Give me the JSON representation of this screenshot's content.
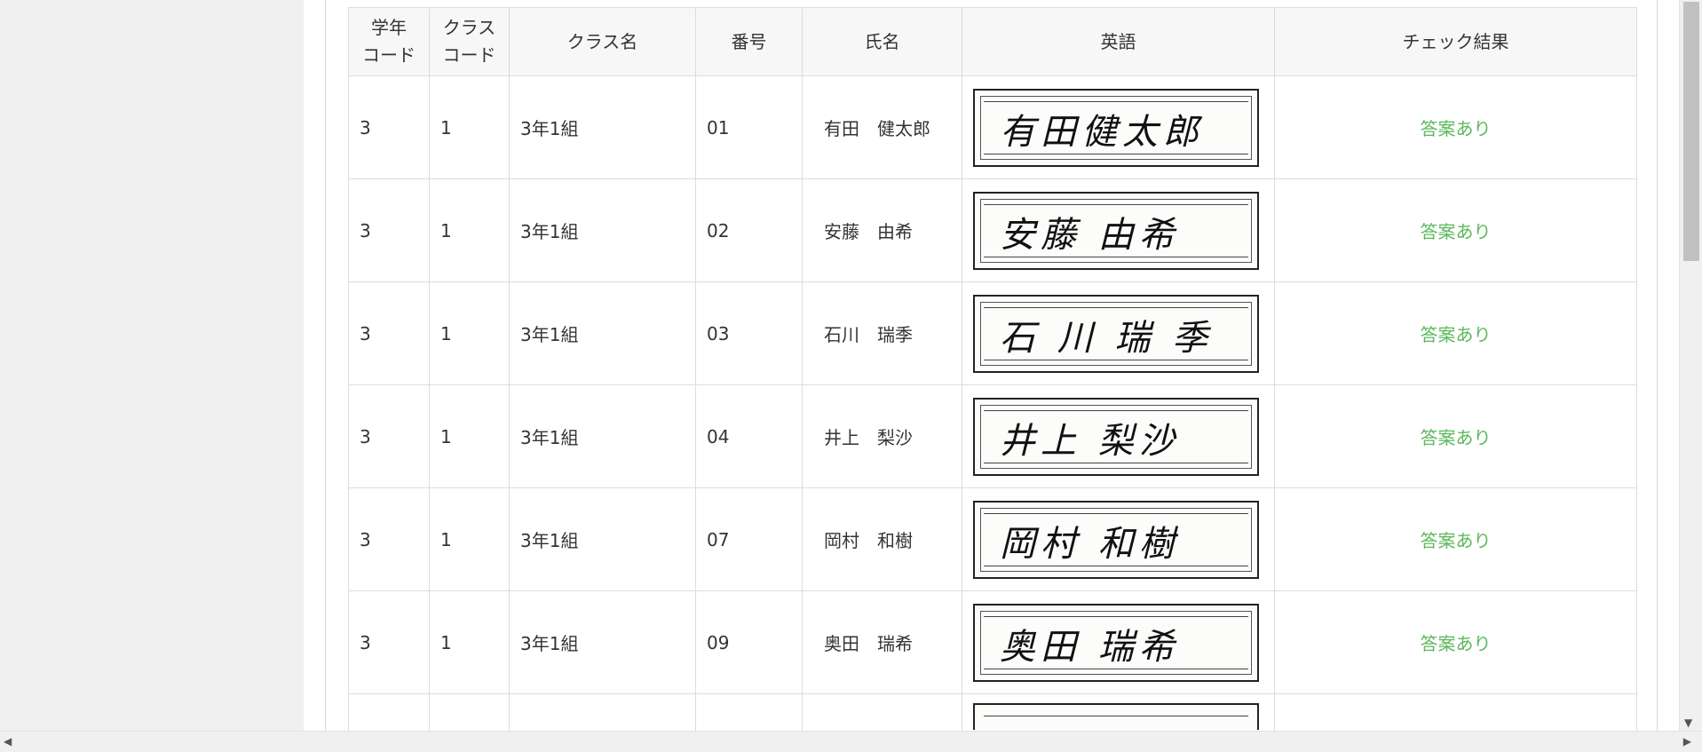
{
  "table": {
    "headers": [
      "学年\nコード",
      "クラス\nコード",
      "クラス名",
      "番号",
      "氏名",
      "英語",
      "チェック結果"
    ],
    "header_lines": [
      [
        "学年",
        "コード"
      ],
      [
        "クラス",
        "コード"
      ],
      [
        "クラス名"
      ],
      [
        "番号"
      ],
      [
        "氏名"
      ],
      [
        "英語"
      ],
      [
        "チェック結果"
      ]
    ],
    "rows": [
      {
        "grade": "3",
        "class_code": "1",
        "class_name": "3年1組",
        "number": "01",
        "name": "有田　健太郎",
        "signature": "有田健太郎",
        "result": "答案あり"
      },
      {
        "grade": "3",
        "class_code": "1",
        "class_name": "3年1組",
        "number": "02",
        "name": "安藤　由希",
        "signature": "安藤 由希",
        "result": "答案あり"
      },
      {
        "grade": "3",
        "class_code": "1",
        "class_name": "3年1組",
        "number": "03",
        "name": "石川　瑞季",
        "signature": "石 川 瑞 季",
        "result": "答案あり"
      },
      {
        "grade": "3",
        "class_code": "1",
        "class_name": "3年1組",
        "number": "04",
        "name": "井上　梨沙",
        "signature": "井上 梨沙",
        "result": "答案あり"
      },
      {
        "grade": "3",
        "class_code": "1",
        "class_name": "3年1組",
        "number": "07",
        "name": "岡村　和樹",
        "signature": "岡村 和樹",
        "result": "答案あり"
      },
      {
        "grade": "3",
        "class_code": "1",
        "class_name": "3年1組",
        "number": "09",
        "name": "奥田　瑞希",
        "signature": "奥田 瑞希",
        "result": "答案あり"
      }
    ]
  },
  "colors": {
    "result_green": "#5cb85c",
    "header_bg": "#f7f7f7",
    "border": "#dcdcdc"
  },
  "icons": {
    "scroll_down": "scroll-down-arrow-icon",
    "scroll_left": "scroll-left-arrow-icon",
    "scroll_right": "scroll-right-arrow-icon"
  }
}
